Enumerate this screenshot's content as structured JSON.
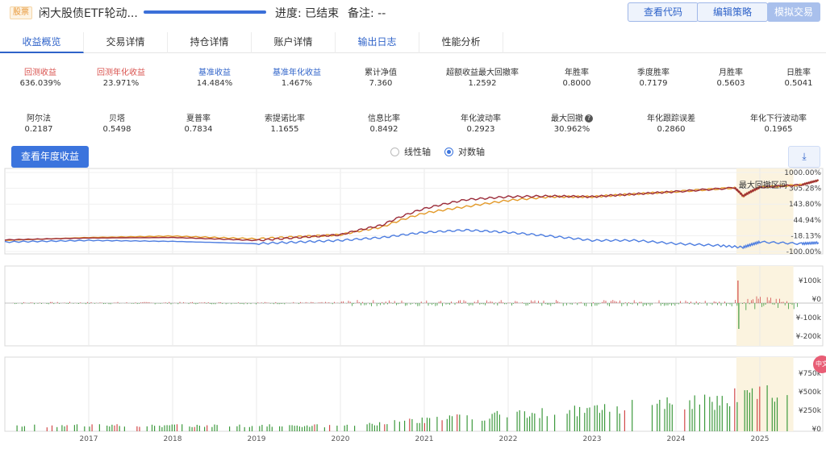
{
  "header": {
    "badge": "股票",
    "strategy_name": "闲大股债ETF轮动...",
    "progress_pct": 100,
    "progress_text": "进度: 已结束",
    "note_text": "备注: --",
    "buttons": {
      "view_code": "查看代码",
      "edit_strategy": "编辑策略",
      "paper_trade": "模拟交易"
    }
  },
  "tabs": [
    "收益概览",
    "交易详情",
    "持仓详情",
    "账户详情",
    "输出日志",
    "性能分析"
  ],
  "metrics_row1": [
    {
      "label": "回测收益",
      "value": "636.039%",
      "color": "red"
    },
    {
      "label": "回测年化收益",
      "value": "23.971%",
      "color": "red"
    },
    {
      "label": "基准收益",
      "value": "14.484%",
      "color": "blue"
    },
    {
      "label": "基准年化收益",
      "value": "1.467%",
      "color": "blue"
    },
    {
      "label": "累计净值",
      "value": "7.360",
      "color": "default"
    },
    {
      "label": "超额收益最大回撤率",
      "value": "1.2592",
      "color": "default"
    },
    {
      "label": "年胜率",
      "value": "0.8000",
      "color": "default"
    },
    {
      "label": "季度胜率",
      "value": "0.7179",
      "color": "default"
    },
    {
      "label": "月胜率",
      "value": "0.5603",
      "color": "default"
    },
    {
      "label": "日胜率",
      "value": "0.5041",
      "color": "default"
    }
  ],
  "metrics_row2": [
    {
      "label": "阿尔法",
      "value": "0.2187"
    },
    {
      "label": "贝塔",
      "value": "0.5498"
    },
    {
      "label": "夏普率",
      "value": "0.7834"
    },
    {
      "label": "索提诺比率",
      "value": "1.1655"
    },
    {
      "label": "信息比率",
      "value": "0.8492"
    },
    {
      "label": "年化波动率",
      "value": "0.2923"
    },
    {
      "label": "最大回撤",
      "value": "30.962%",
      "help_icon": "?"
    },
    {
      "label": "年化跟踪误差",
      "value": "0.2860"
    },
    {
      "label": "年化下行波动率",
      "value": "0.1965"
    }
  ],
  "controls": {
    "annual_button": "查看年度收益",
    "linear_axis": "线性轴",
    "log_axis": "对数轴",
    "selected_axis": "log",
    "download_icon": "download-icon",
    "download_glyph": "⤓"
  },
  "side_badge": "中文",
  "chart_data": [
    {
      "type": "line",
      "x_ticks": [
        "2017",
        "2018",
        "2019",
        "2020",
        "2021",
        "2022",
        "2023",
        "2024",
        "2025"
      ],
      "y_scale": "log",
      "y_tick_labels": [
        "1000.00%",
        "305.28%",
        "143.80%",
        "44.94%",
        "-18.13%",
        "-100.00%"
      ],
      "annotation": "最大回撤区间",
      "colors": {
        "strategy": "#e39a2a",
        "excess": "#9b2c3a",
        "benchmark": "#4d7de0",
        "highlight": "#fbf3df"
      },
      "series": [
        {
          "role": "strategy",
          "x": [
            2016.0,
            2017.0,
            2018.0,
            2019.0,
            2019.5,
            2020.0,
            2020.5,
            2021.0,
            2021.5,
            2022.0,
            2022.5,
            2023.0,
            2024.0,
            2024.7,
            2024.8,
            2025.0,
            2025.5,
            2025.7
          ],
          "y": [
            -5,
            5,
            10,
            0,
            8,
            15,
            50,
            140,
            200,
            270,
            320,
            320,
            400,
            470,
            330,
            480,
            530,
            636
          ]
        },
        {
          "role": "excess",
          "x": [
            2016.0,
            2017.0,
            2018.0,
            2019.0,
            2019.5,
            2020.0,
            2020.5,
            2021.0,
            2021.5,
            2022.0,
            2022.5,
            2023.0,
            2024.0,
            2024.7,
            2024.8,
            2025.0,
            2025.5,
            2025.7
          ],
          "y": [
            -3,
            3,
            5,
            -5,
            5,
            15,
            60,
            180,
            280,
            320,
            330,
            320,
            400,
            470,
            330,
            480,
            530,
            636
          ]
        },
        {
          "role": "benchmark",
          "x": [
            2016.0,
            2017.0,
            2018.0,
            2019.0,
            2019.5,
            2020.0,
            2020.5,
            2021.0,
            2021.5,
            2022.0,
            2022.5,
            2023.0,
            2023.5,
            2024.0,
            2024.5,
            2024.8,
            2025.0,
            2025.5,
            2025.7
          ],
          "y": [
            -10,
            -5,
            -8,
            -15,
            -10,
            -5,
            5,
            25,
            35,
            25,
            10,
            -5,
            -5,
            -15,
            -20,
            -25,
            -10,
            -15,
            -12
          ]
        }
      ]
    },
    {
      "type": "bar",
      "y_tick_labels": [
        "¥100k",
        "¥0",
        "¥-100k",
        "¥-200k"
      ],
      "colors": {
        "positive": "#d24a4a",
        "negative": "#3d9a3d"
      }
    },
    {
      "type": "bar",
      "y_tick_labels": [
        "¥750k",
        "¥500k",
        "¥250k",
        "¥0"
      ],
      "colors": {
        "positive": "#3d9a3d",
        "negative": "#d24a4a"
      }
    }
  ]
}
